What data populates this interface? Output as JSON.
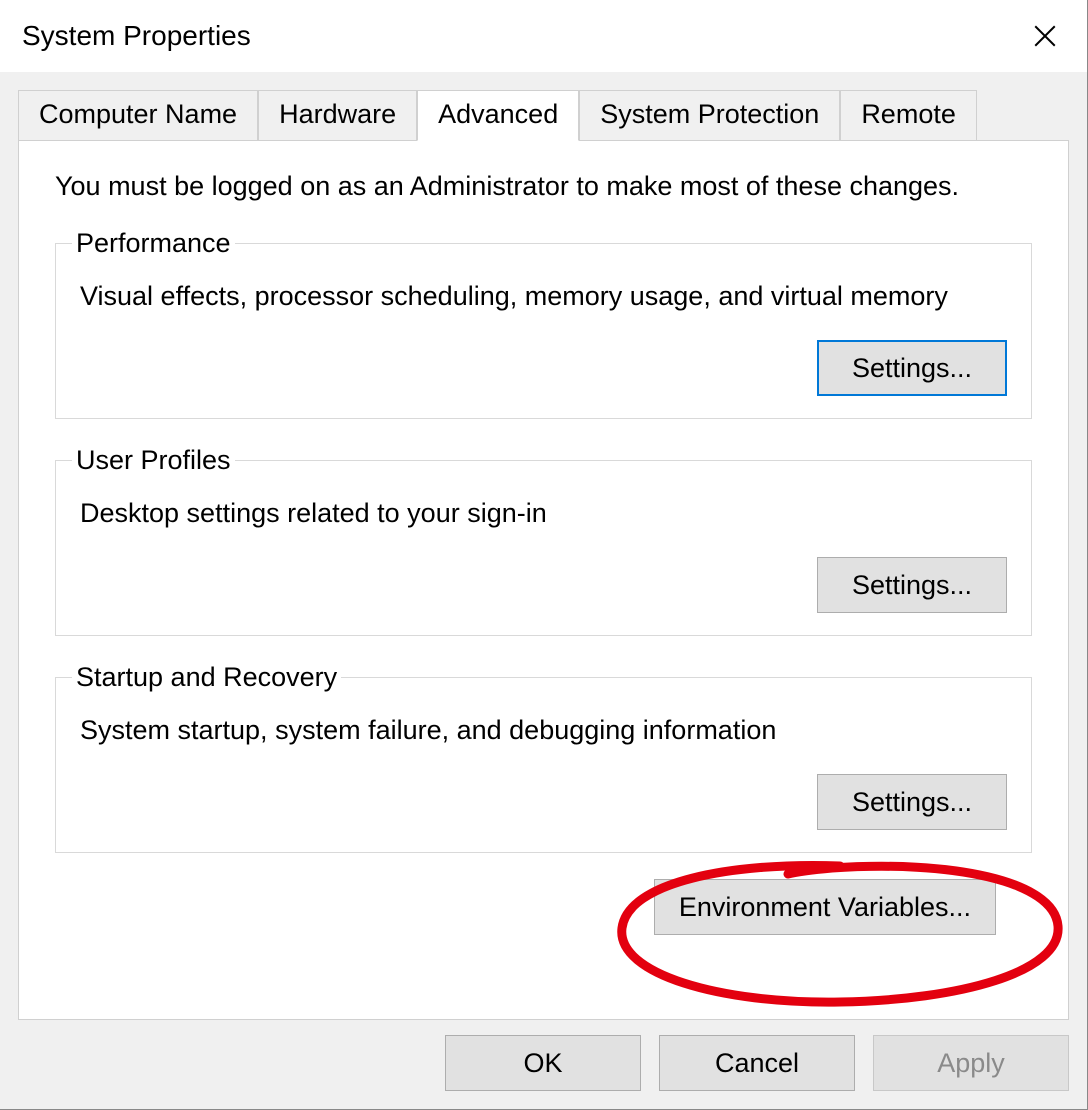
{
  "window": {
    "title": "System Properties"
  },
  "tabs": [
    {
      "label": "Computer Name",
      "active": false
    },
    {
      "label": "Hardware",
      "active": false
    },
    {
      "label": "Advanced",
      "active": true
    },
    {
      "label": "System Protection",
      "active": false
    },
    {
      "label": "Remote",
      "active": false
    }
  ],
  "advanced": {
    "admin_note": "You must be logged on as an Administrator to make most of these changes.",
    "performance": {
      "legend": "Performance",
      "desc": "Visual effects, processor scheduling, memory usage, and virtual memory",
      "settings_label": "Settings..."
    },
    "user_profiles": {
      "legend": "User Profiles",
      "desc": "Desktop settings related to your sign-in",
      "settings_label": "Settings..."
    },
    "startup_recovery": {
      "legend": "Startup and Recovery",
      "desc": "System startup, system failure, and debugging information",
      "settings_label": "Settings..."
    },
    "env_vars_label": "Environment Variables..."
  },
  "dialog_buttons": {
    "ok": "OK",
    "cancel": "Cancel",
    "apply": "Apply"
  },
  "annotation": {
    "type": "hand-drawn-circle",
    "target": "environment-variables-button",
    "color": "#e3000f"
  }
}
